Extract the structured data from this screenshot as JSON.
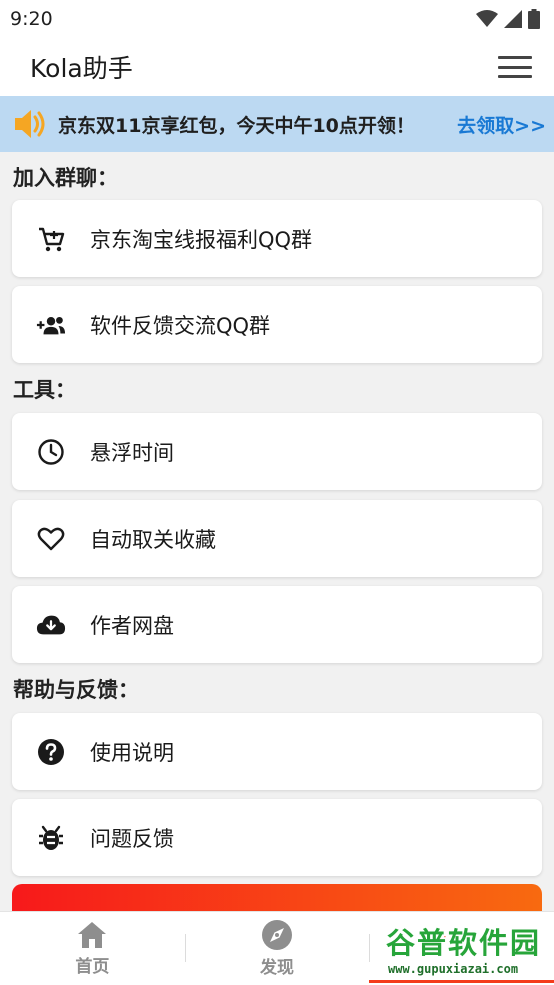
{
  "status_bar": {
    "time": "9:20"
  },
  "app_bar": {
    "title": "Kola助手"
  },
  "notice": {
    "text": "京东双11京享红包，今天中午10点开领！",
    "link": "去领取>>"
  },
  "sections": [
    {
      "title": "加入群聊："
    },
    {
      "title": "工具："
    },
    {
      "title": "帮助与反馈："
    }
  ],
  "items": {
    "jd_taobao_qq": {
      "label": "京东淘宝线报福利QQ群",
      "icon": "shopping-cart-icon"
    },
    "feedback_qq": {
      "label": "软件反馈交流QQ群",
      "icon": "group-add-icon"
    },
    "float_time": {
      "label": "悬浮时间",
      "icon": "clock-icon"
    },
    "auto_unfav": {
      "label": "自动取关收藏",
      "icon": "heart-icon"
    },
    "author_disk": {
      "label": "作者网盘",
      "icon": "cloud-download-icon"
    },
    "instructions": {
      "label": "使用说明",
      "icon": "help-icon"
    },
    "bug_report": {
      "label": "问题反馈",
      "icon": "bug-icon"
    }
  },
  "bottom_nav": [
    {
      "label": "首页",
      "icon": "home-icon"
    },
    {
      "label": "发现",
      "icon": "compass-icon"
    },
    {
      "label": "",
      "icon": "profile-icon"
    }
  ],
  "watermark": {
    "top": "谷普软件园",
    "bottom": "www.gupuxiazai.com"
  },
  "colors": {
    "notice_bg": "#bcd9f2",
    "link": "#1979d4",
    "accent_start": "#f7191b",
    "accent_end": "#f86a10",
    "watermark": "#27a53a"
  }
}
